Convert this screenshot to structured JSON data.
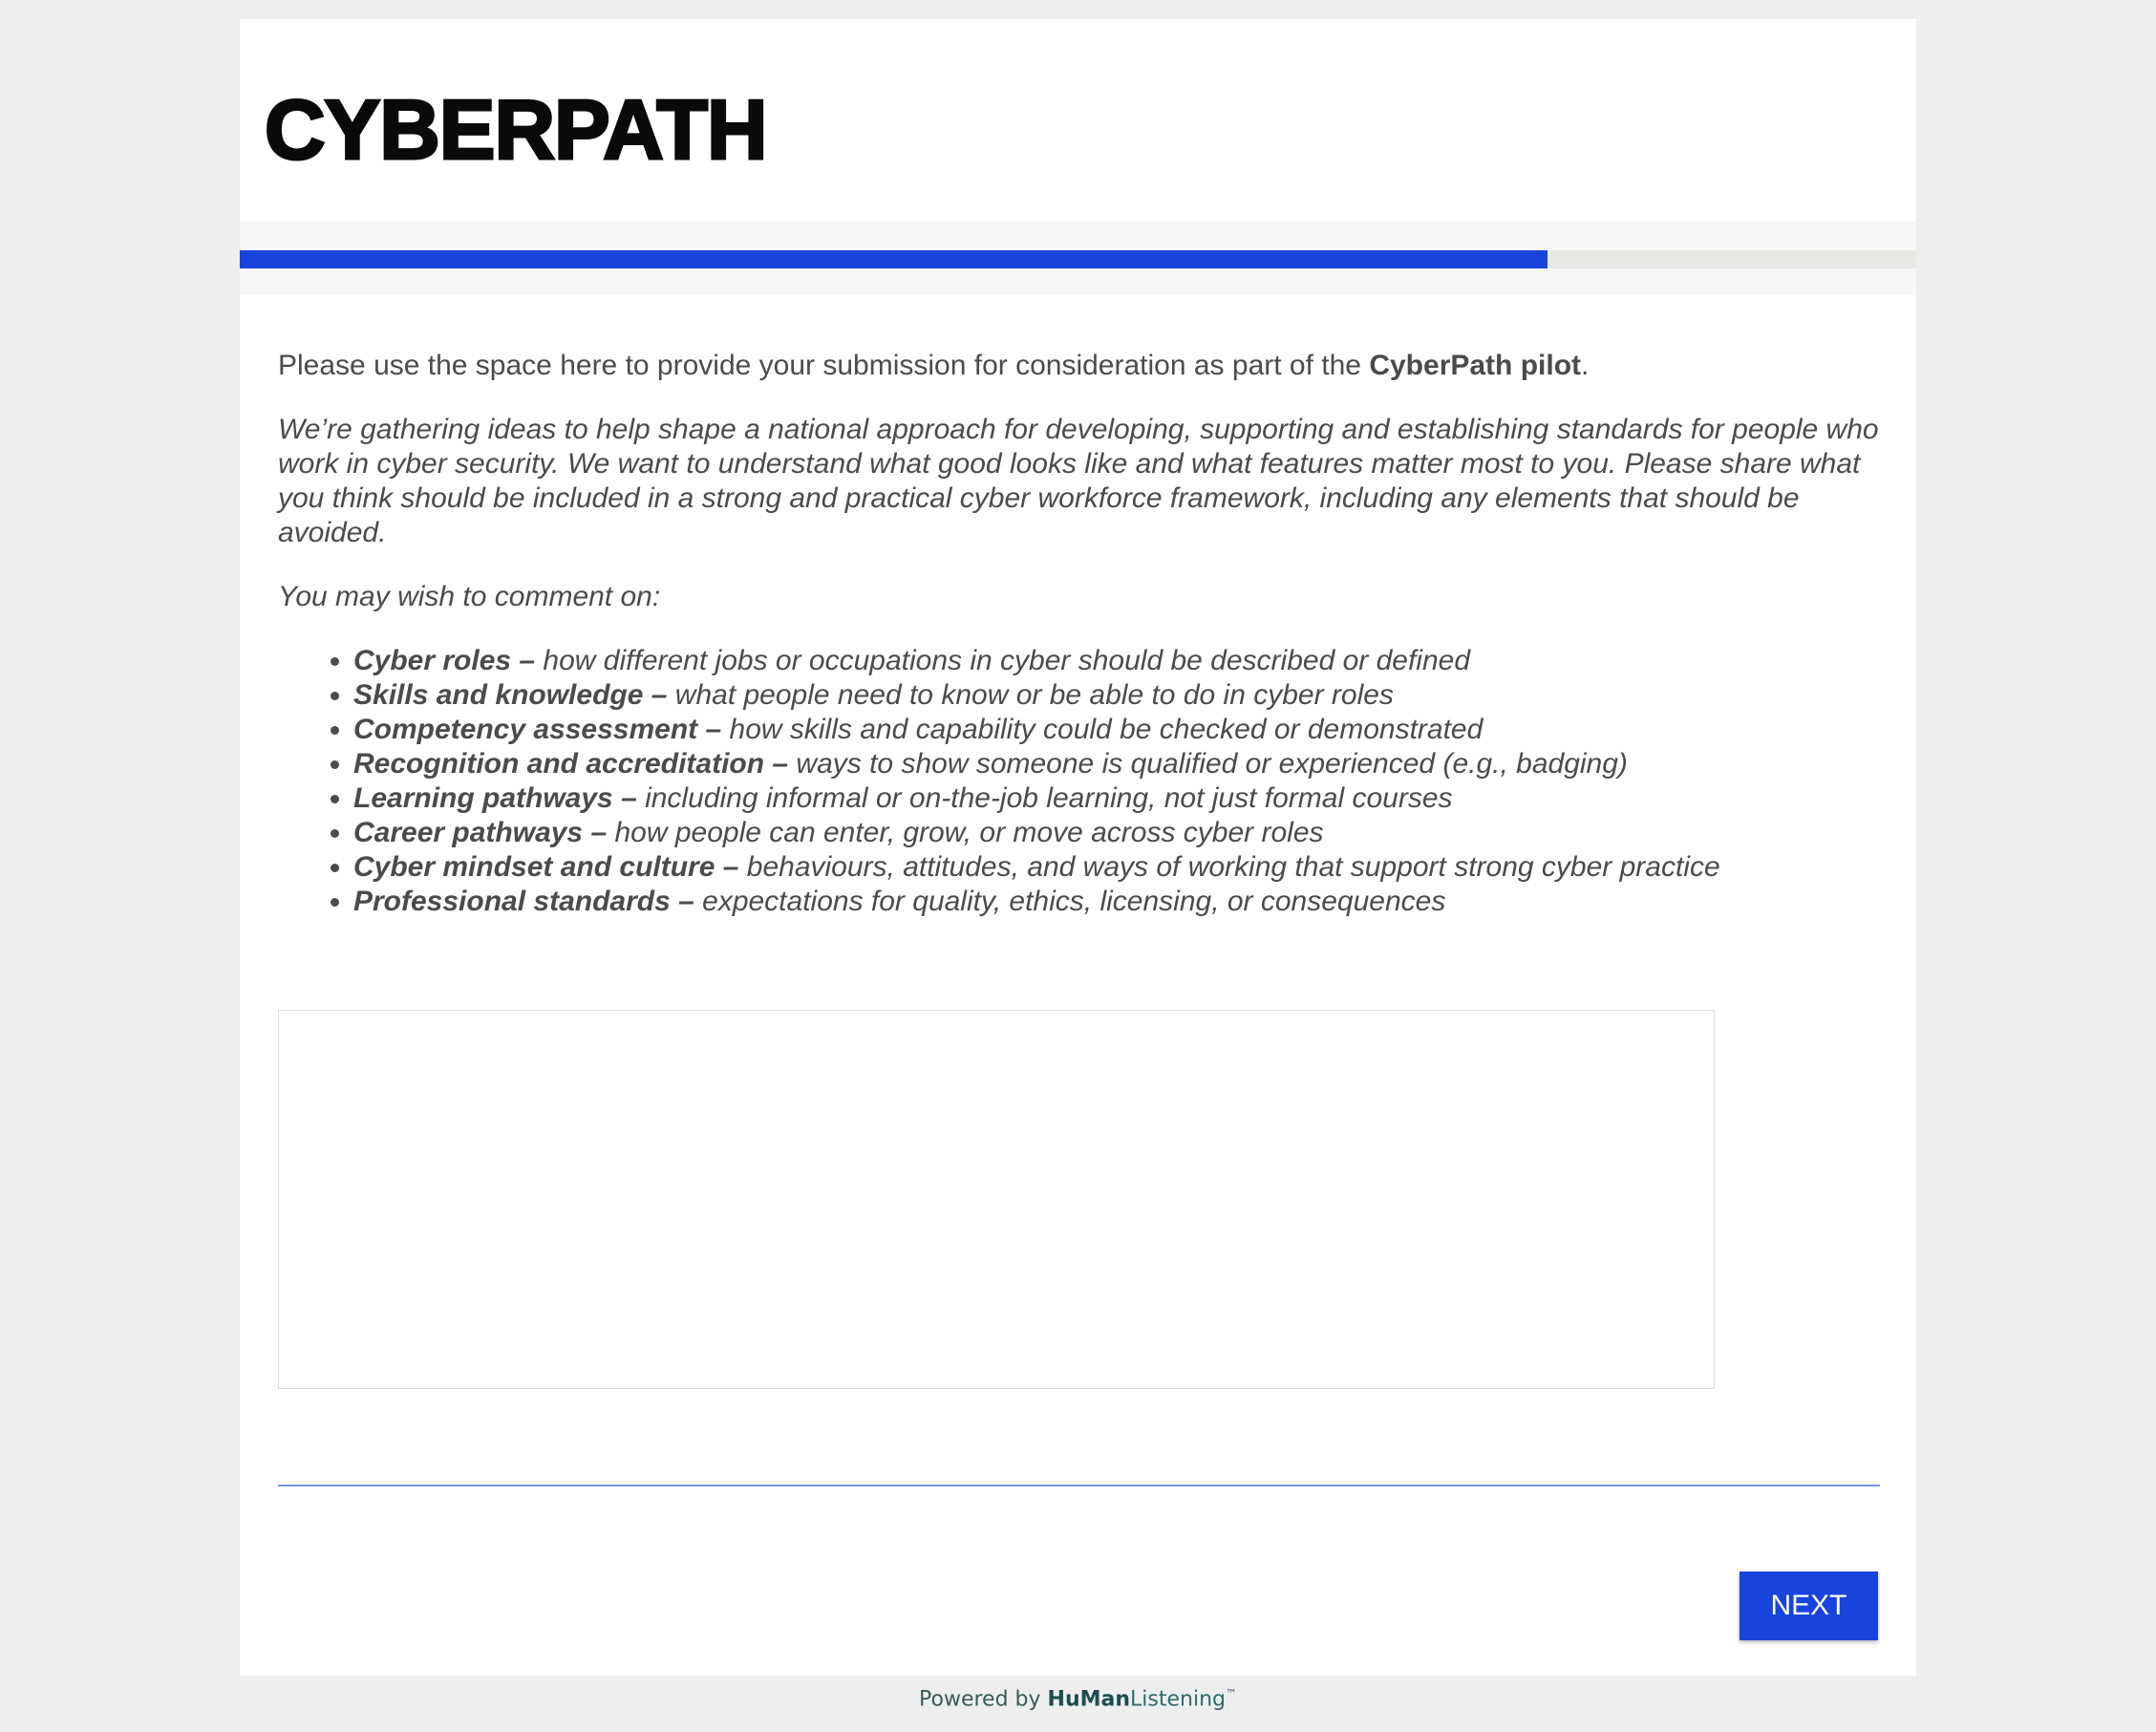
{
  "header": {
    "logo_text": "CYBERPATH"
  },
  "progress": {
    "fraction": 0.78
  },
  "content": {
    "intro_before": "Please use the space here to provide your submission for consideration as part of the ",
    "intro_bold": "CyberPath pilot",
    "intro_after": ".",
    "description": "We’re gathering ideas to help shape a national approach for developing, supporting and establishing standards for people who work in cyber security. We want to understand what good looks like and what features matter most to you. Please share what you think should be included in a strong and practical cyber workforce framework, including any elements that should be avoided.",
    "prompt": "You may wish to comment on:",
    "topics": [
      {
        "title": "Cyber roles –",
        "text": " how different jobs or occupations in cyber should be described or defined"
      },
      {
        "title": "Skills and knowledge –",
        "text": " what people need to know or be able to do in cyber roles"
      },
      {
        "title": "Competency assessment –",
        "text": " how skills and capability could be checked or demonstrated"
      },
      {
        "title": "Recognition and accreditation –",
        "text": " ways to show someone is qualified or experienced (e.g., badging)"
      },
      {
        "title": "Learning pathways –",
        "text": " including informal or on-the-job learning, not just formal courses"
      },
      {
        "title": "Career pathways –",
        "text": " how people can enter, grow, or move across cyber roles"
      },
      {
        "title": "Cyber mindset and culture –",
        "text": " behaviours, attitudes, and ways of working that support strong cyber practice"
      },
      {
        "title": "Professional standards –",
        "text": " expectations for quality, ethics, licensing, or consequences"
      }
    ]
  },
  "answer": {
    "value": ""
  },
  "actions": {
    "next_label": "NEXT"
  },
  "footer": {
    "powered_by": "Powered by ",
    "brand_part1": "HuMan",
    "brand_part2": "Listening",
    "trademark": "™"
  },
  "colors": {
    "accent": "#1844dc",
    "page_background": "#eeeeee",
    "text": "#4b4b4b"
  }
}
